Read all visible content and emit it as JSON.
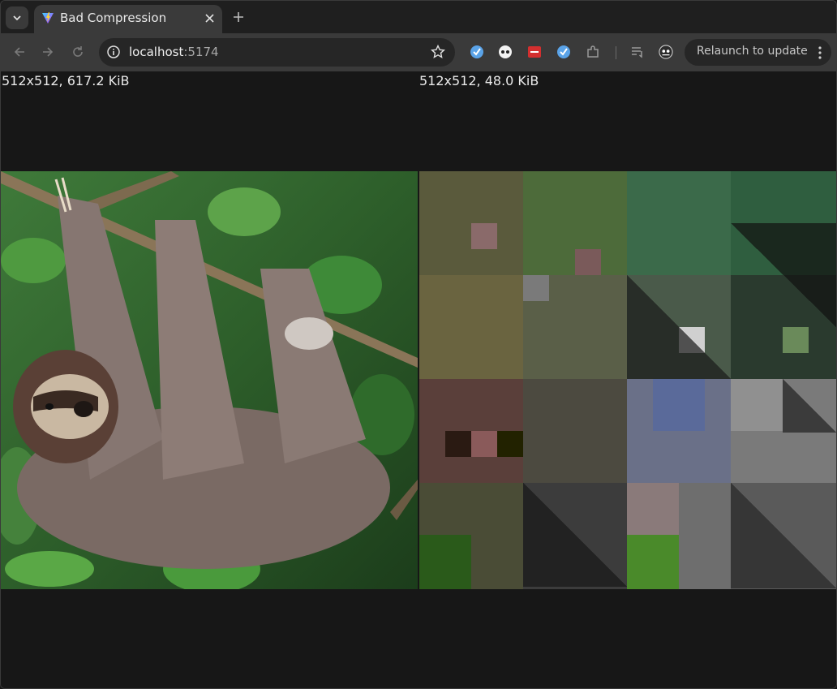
{
  "browser": {
    "tab_title": "Bad Compression",
    "url_host": "localhost",
    "url_port": ":5174",
    "relaunch_label": "Relaunch to update"
  },
  "images": {
    "original_label": "512x512, 617.2 KiB",
    "compressed_label": "512x512, 48.0 KiB"
  },
  "icons": {
    "tab_search": "chevron-down-icon",
    "favicon": "vite-favicon-icon",
    "close": "close-icon",
    "new_tab": "plus-icon",
    "back": "arrow-left-icon",
    "forward": "arrow-right-icon",
    "reload": "reload-icon",
    "site_info": "info-icon",
    "bookmark": "star-icon",
    "extensions": [
      "bitwarden-icon",
      "eyes-extension-icon",
      "red-extension-icon",
      "bitwarden-icon",
      "puzzle-icon"
    ],
    "reading_list": "reading-list-icon",
    "profile": "profile-avatar-icon",
    "menu": "kebab-menu-icon"
  },
  "colors": {
    "page_background": "#171717",
    "toolbar": "#3a3a3a",
    "tabstrip": "#1f1f1f"
  }
}
